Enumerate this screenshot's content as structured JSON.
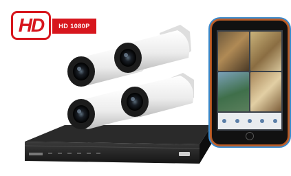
{
  "badge": {
    "hd_label": "HD",
    "resolution_label": "HD 1080P"
  },
  "colors": {
    "brand_red": "#d7161d",
    "camera_body": "#f2f2f2",
    "camera_face": "#1c1c1c",
    "dvr_body": "#1a1a1a",
    "tablet_accent_orange": "#d56a2e",
    "tablet_accent_blue": "#3c8fd4"
  },
  "scene": {
    "camera_count": 4,
    "tablet_feed_count": 4,
    "tablet_toolbar_icon_count": 5
  }
}
